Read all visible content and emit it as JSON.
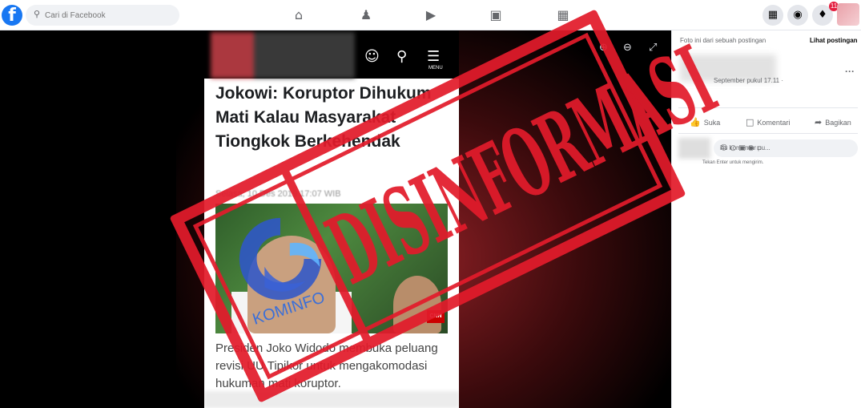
{
  "topbar": {
    "logo": "f",
    "search_placeholder": "Cari di Facebook",
    "nav_icons": [
      "home-icon",
      "friends-icon",
      "watch-icon",
      "marketplace-icon",
      "gaming-icon"
    ],
    "right_icons": [
      "menu-grid-icon",
      "messenger-icon",
      "notifications-icon"
    ],
    "notif_count": "11"
  },
  "viewer": {
    "controls": [
      "zoom-in-icon",
      "zoom-out-icon",
      "fullscreen-icon"
    ]
  },
  "article": {
    "menu_label": "MENU",
    "headline": "Jokowi: Koruptor Dihukum Mati Kalau Masyarakat Tiongkok Berkehendak",
    "dateline": "Selasa, 10 Des 2019 17:07 WIB",
    "body_part1": "Presiden Joko Widodo membuka peluang revisi UU Tipikor untuk mengakomodasi hukuman mati koruptor.",
    "photo_badge": "CNN",
    "watermark": "KOMINFO"
  },
  "side": {
    "info_note": "Foto ini dari sebuah postingan",
    "see_post": "Lihat postingan",
    "post_date": "September pukul 17.11 · ",
    "like": "Suka",
    "comment": "Komentari",
    "share": "Bagikan",
    "comment_placeholder": "ilis komentar pu...",
    "enter_hint": "Tekan Enter untuk mengirim."
  },
  "stamp": {
    "text": "DISINFORMASI",
    "color": "#e21b2b"
  },
  "colors": {
    "brand": "#1877f2",
    "stamp_red": "#e21b2b",
    "notif_red": "#e41e3f"
  }
}
